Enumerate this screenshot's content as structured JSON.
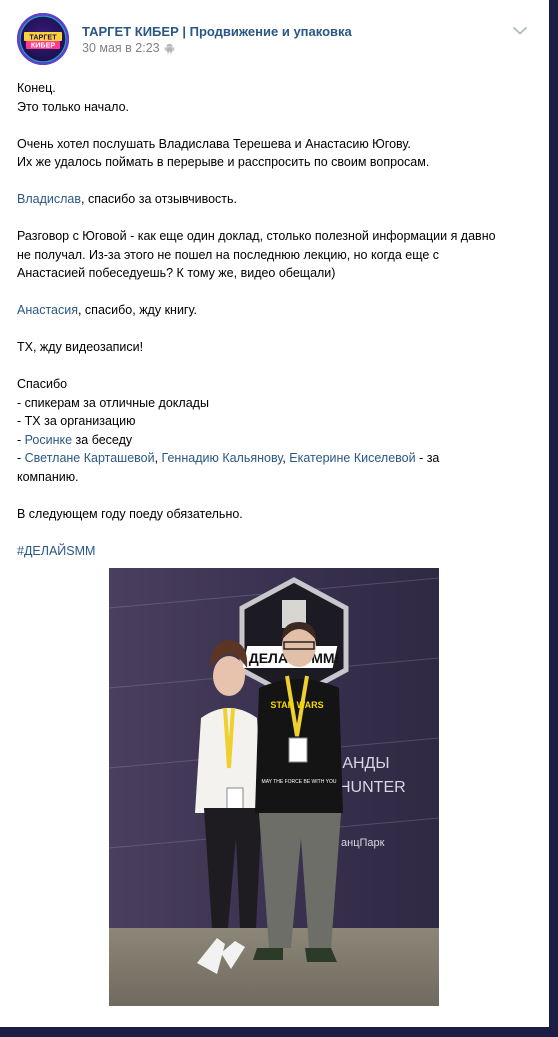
{
  "header": {
    "author": "ТАРГЕТ КИБЕР | Продвижение и упаковка",
    "date": "30 мая в 2:23",
    "avatar_lines": [
      "ТАРГЕТ",
      "КИБЕР"
    ]
  },
  "icons": {
    "platform": "android-icon",
    "menu": "chevron-down-icon"
  },
  "colors": {
    "link": "#2a5885",
    "frame": "#1b1d45",
    "text": "#000000",
    "muted": "#828282"
  },
  "post": {
    "p1": [
      "Конец.",
      "Это только начало."
    ],
    "p2": [
      "Очень хотел послушать Владислава Терешева и Анастасию Югову.",
      "Их же удалось поймать в перерыве и расспросить по своим вопросам."
    ],
    "p3": {
      "link": "Владислав",
      "text": ", спасибо за отзывчивость."
    },
    "p4": [
      "Разговор с Юговой - как еще один доклад, столько полезной информации я давно",
      "не получал. Из-за этого не пошел на последнюю лекцию, но когда еще с",
      "Анастасией побеседуешь? К тому же, видео обещали)"
    ],
    "p5": {
      "link": "Анастасия",
      "text": ", спасибо, жду книгу."
    },
    "p6": "ТХ, жду видеозаписи!",
    "thanks": {
      "title": "Спасибо",
      "item1": "- спикерам за отличные доклады",
      "item2": "- ТХ за организацию",
      "item3_prefix": "- ",
      "item3_link": "Росинке",
      "item3_text": " за беседу",
      "item4_prefix": "- ",
      "item4_link1": "Светлане Карташевой",
      "item4_sep1": ", ",
      "item4_link2": "Геннадию Кальянову",
      "item4_sep2": ", ",
      "item4_link3": "Екатерине Киселевой",
      "item4_text": " - за",
      "item4_cont": "компанию."
    },
    "p8": "В следующем году поеду обязательно.",
    "hashtag": "#ДЕЛАЙSMM"
  },
  "photo": {
    "banner_text": "ДЕЛАЙ SMM!",
    "wall_text_1": "МАНДЫ",
    "wall_text_2": "HUNTER",
    "wall_text_3": "анцПарк",
    "shirt_text": "MAY THE FORCE BE WITH YOU",
    "shirt_logo": "STAR WARS"
  }
}
